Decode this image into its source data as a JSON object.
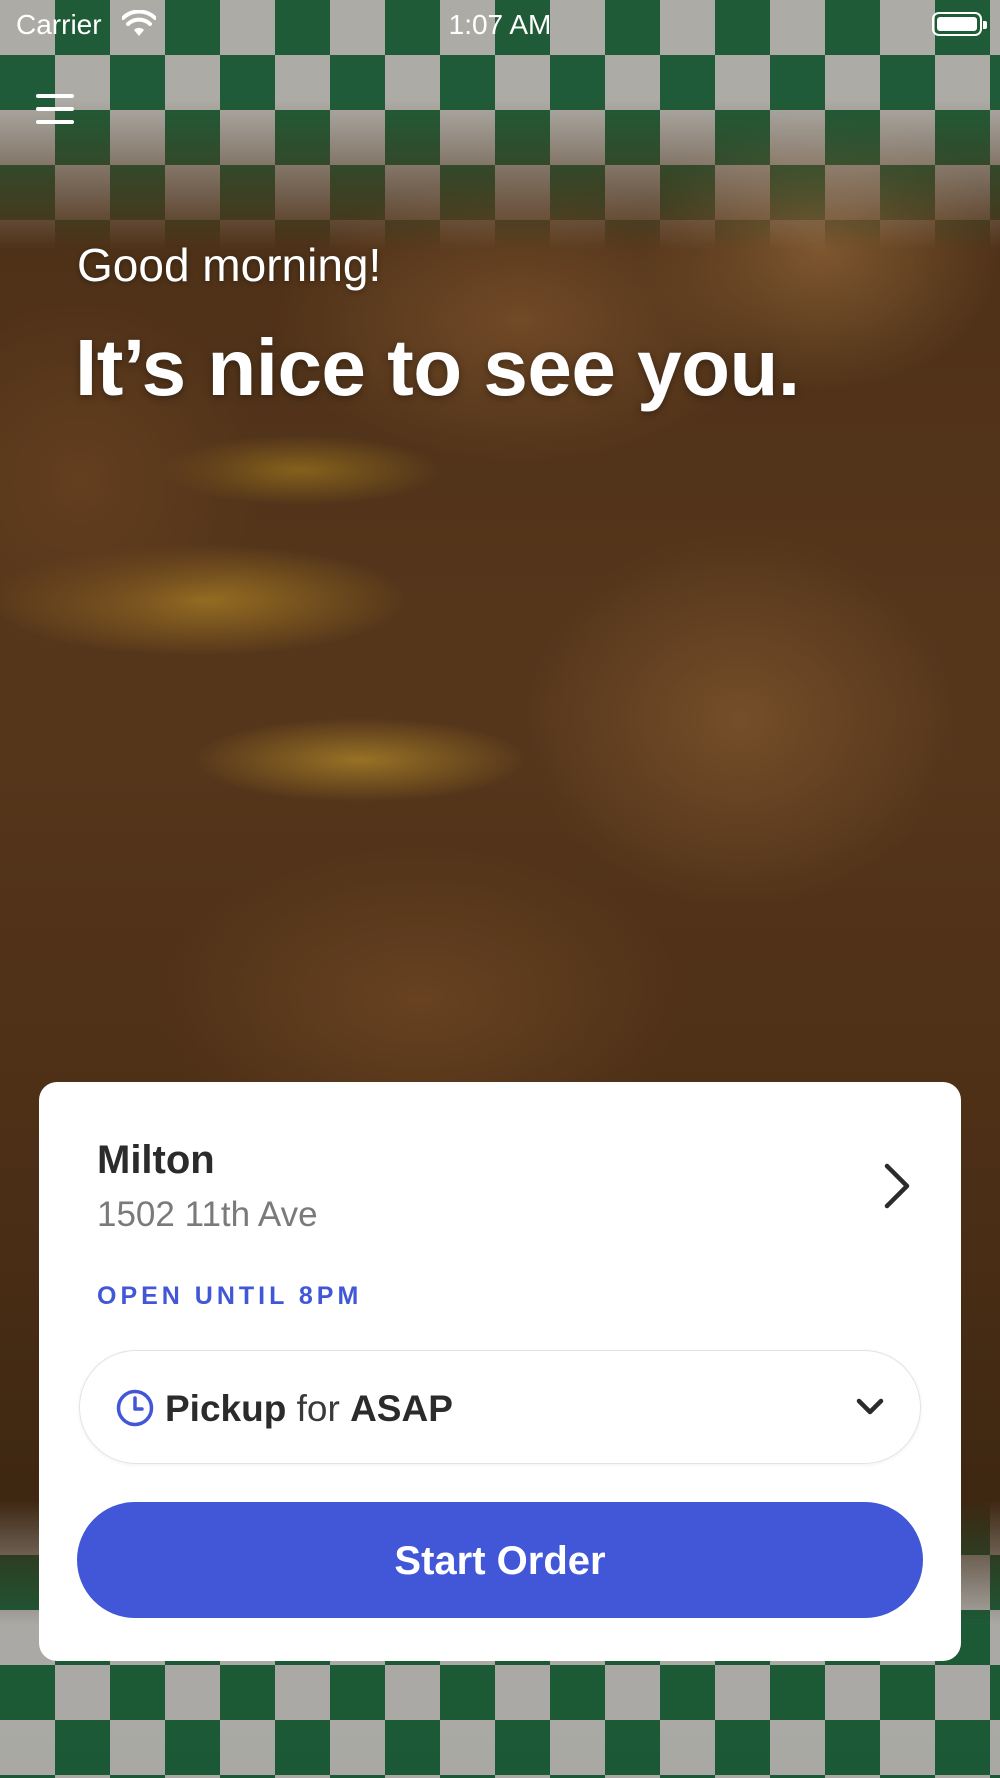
{
  "status_bar": {
    "carrier": "Carrier",
    "time": "1:07 AM"
  },
  "menu": {
    "icon": "hamburger-menu-icon"
  },
  "greeting": {
    "subtitle": "Good morning!",
    "title": "It’s nice to see you."
  },
  "location": {
    "name": "Milton",
    "address": "1502 11th Ave",
    "hours": "OPEN UNTIL 8PM"
  },
  "order_type": {
    "mode": "Pickup",
    "connector": "for",
    "time": "ASAP",
    "icon": "clock-icon"
  },
  "actions": {
    "start_order": "Start Order"
  },
  "colors": {
    "accent": "#4157d8",
    "card": "#ffffff",
    "text_dark": "#2b2b2b",
    "text_muted": "#7a7a7a"
  }
}
